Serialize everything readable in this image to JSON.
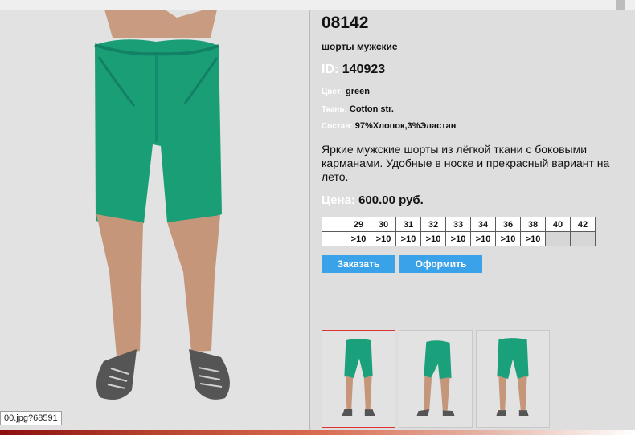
{
  "product": {
    "sku": "08142",
    "title": "шорты мужские",
    "id_label": "ID:",
    "id_value": "140923",
    "attributes": [
      {
        "label": "Цвет:",
        "value": "green"
      },
      {
        "label": "Ткань:",
        "value": "Cotton str."
      },
      {
        "label": "Состав:",
        "value": "97%Хлопок,3%Эластан"
      }
    ],
    "description": "Яркие мужские шорты из лёгкой ткани с боковыми карманами. Удобные в носке и прекрасный вариант на лето.",
    "price_label": "Цена:",
    "price_value": "600.00 руб."
  },
  "sizes": {
    "headers": [
      "29",
      "30",
      "31",
      "32",
      "33",
      "34",
      "36",
      "38",
      "40",
      "42"
    ],
    "stock": [
      ">10",
      ">10",
      ">10",
      ">10",
      ">10",
      ">10",
      ">10",
      ">10",
      "",
      ""
    ]
  },
  "buttons": {
    "order": "Заказать",
    "checkout": "Оформить"
  },
  "status": {
    "tooltip": "00.jpg?68591"
  },
  "colors": {
    "panel_background": "#dedede",
    "button_blue": "#3aa2e8",
    "thumbnail_active_border": "#dd3333"
  },
  "icons": {
    "images": "product-photo"
  }
}
